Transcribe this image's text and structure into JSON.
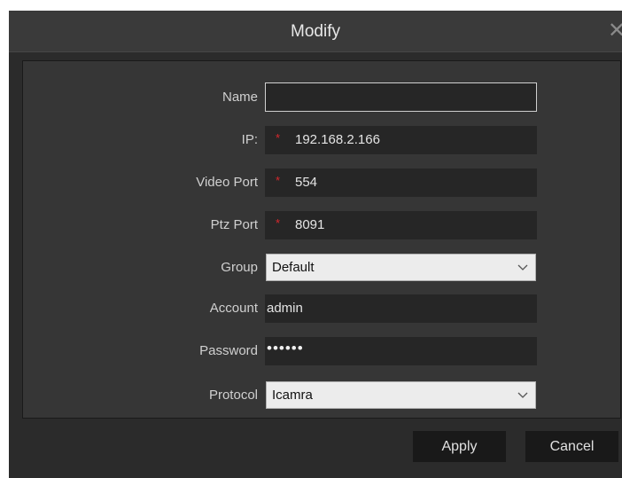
{
  "dialog": {
    "title": "Modify",
    "close_icon": "close-icon"
  },
  "form": {
    "name": {
      "label": "Name",
      "value": ""
    },
    "ip": {
      "label": "IP:",
      "required_mark": "*",
      "value": "192.168.2.166"
    },
    "video_port": {
      "label": "Video Port",
      "required_mark": "*",
      "value": "554"
    },
    "ptz_port": {
      "label": "Ptz Port",
      "required_mark": "*",
      "value": "8091"
    },
    "group": {
      "label": "Group",
      "selected": "Default"
    },
    "account": {
      "label": "Account",
      "value": "admin"
    },
    "password": {
      "label": "Password",
      "value": "••••••"
    },
    "protocol": {
      "label": "Protocol",
      "selected": "Icamra"
    }
  },
  "buttons": {
    "apply": "Apply",
    "cancel": "Cancel"
  },
  "colors": {
    "dialog_bg": "#2b2b2b",
    "panel_bg": "#363636",
    "field_bg": "#262626",
    "required_mark": "#d9272d"
  }
}
